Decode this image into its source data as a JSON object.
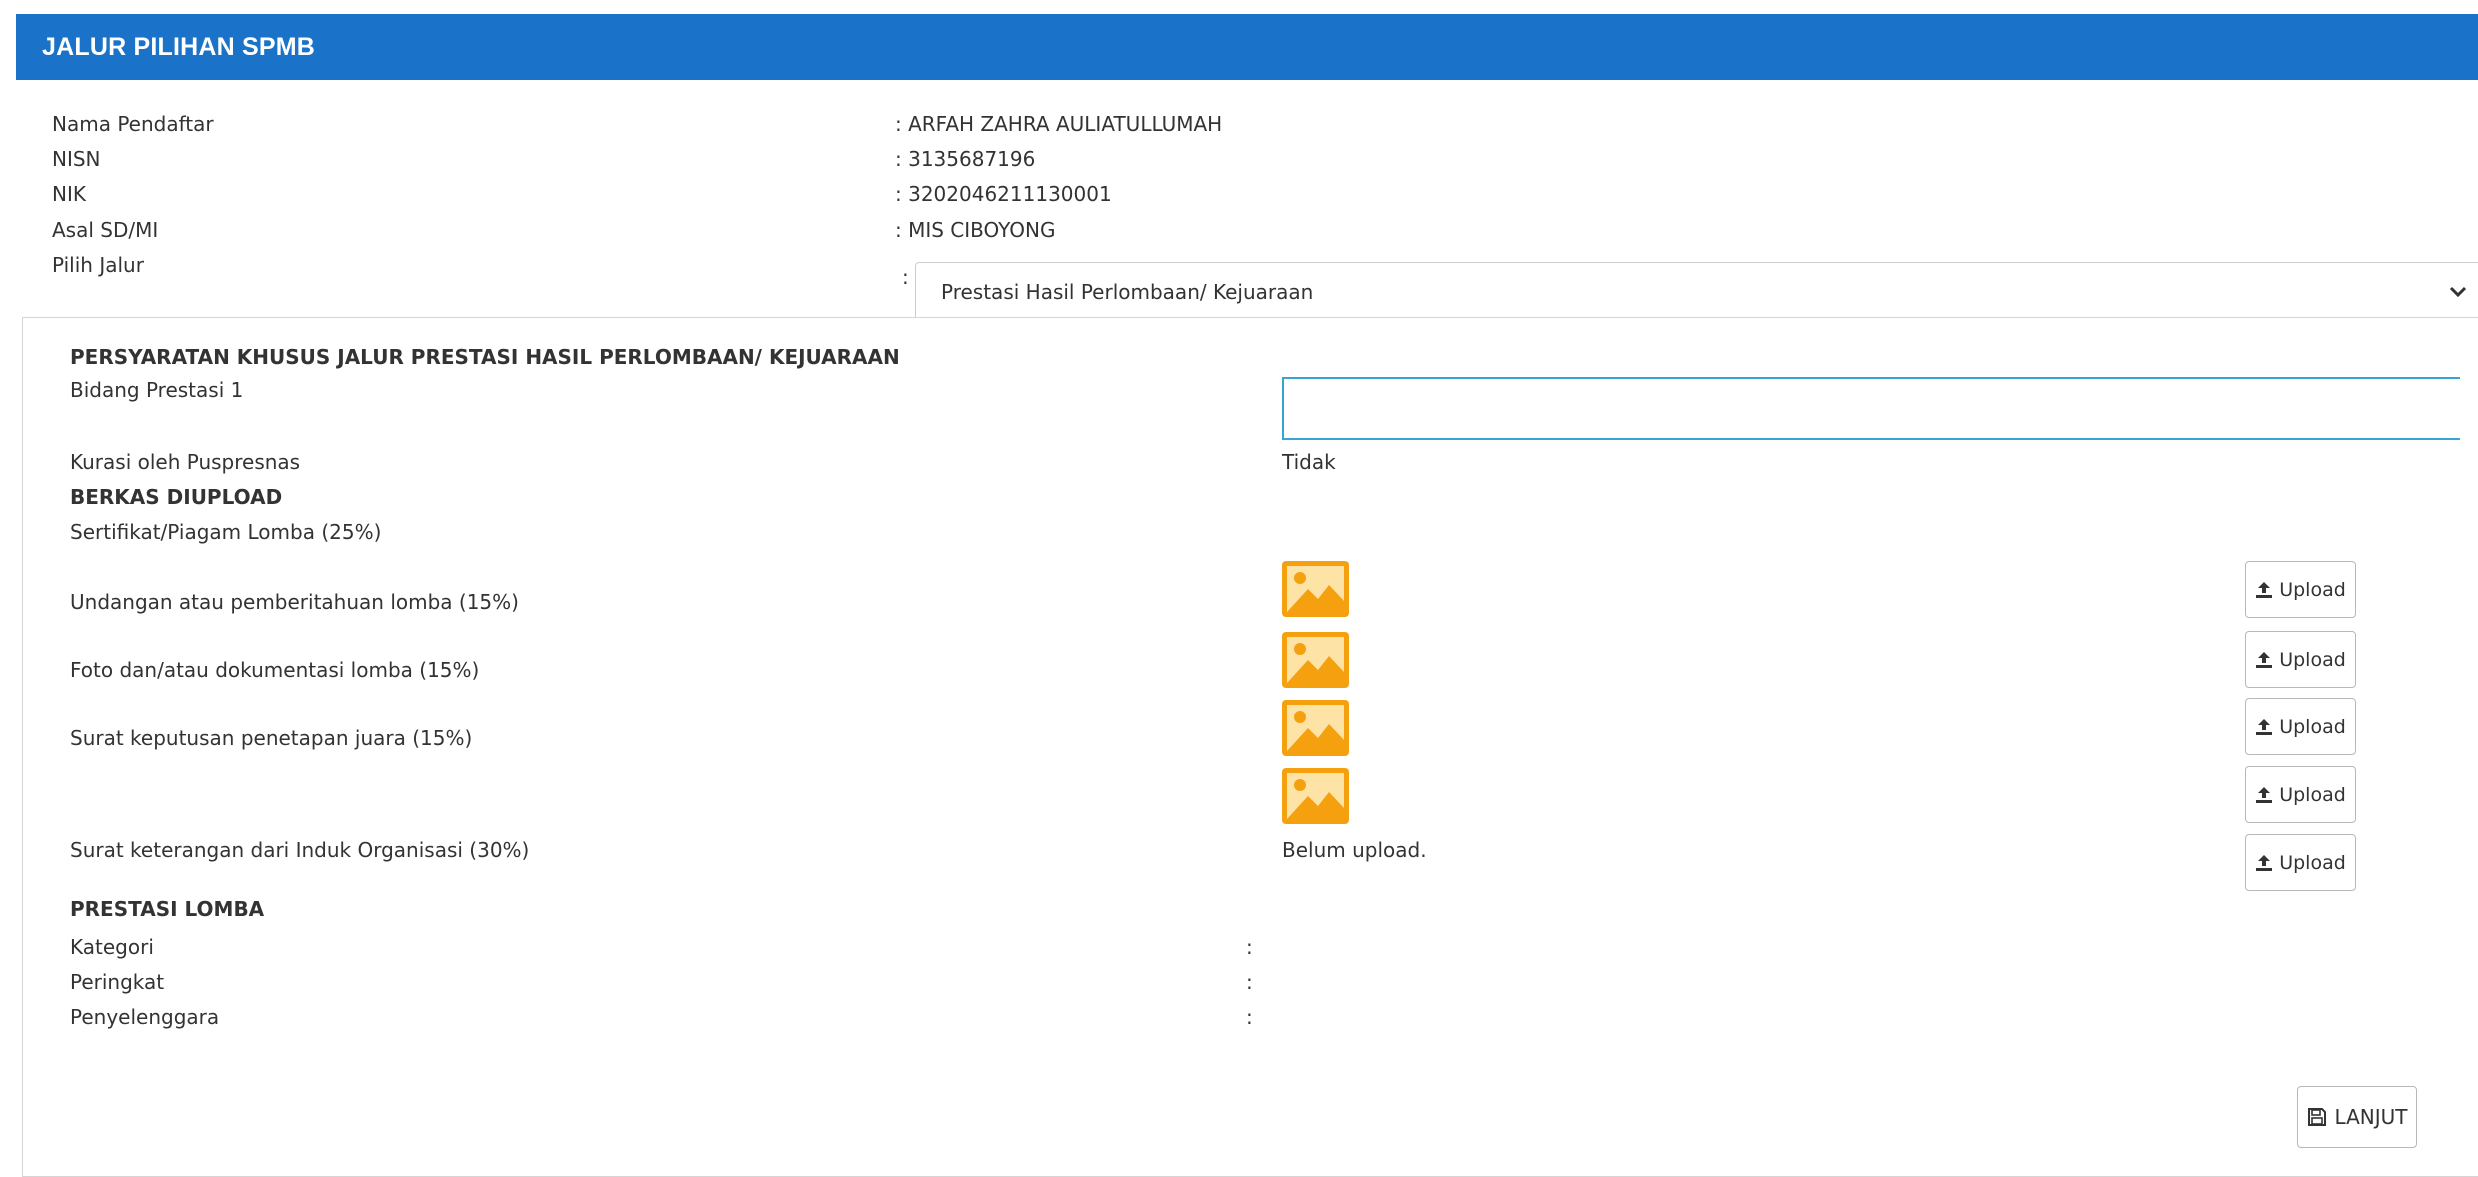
{
  "header": {
    "title": "JALUR PILIHAN SPMB",
    "color": "#1a73c9"
  },
  "student": {
    "rows": [
      {
        "label": "Nama Pendaftar",
        "value": ": ARFAH ZAHRA AULIATULLUMAH"
      },
      {
        "label": "NISN",
        "value": ": 3135687196"
      },
      {
        "label": "NIK",
        "value": ": 3202046211130001"
      },
      {
        "label": "Asal SD/MI",
        "value": ": MIS CIBOYONG"
      }
    ],
    "jalur_label": "Pilih Jalur",
    "jalur_colon": ":",
    "jalur_selected": "Prestasi Hasil Perlombaan/ Kejuaraan"
  },
  "requirements": {
    "heading": "PERSYARATAN KHUSUS JALUR PRESTASI HASIL PERLOMBAAN/ KEJUARAAN",
    "bidang_label": "Bidang Prestasi 1",
    "bidang_value": "",
    "kurasi_label": "Kurasi oleh Puspresnas",
    "kurasi_value": "Tidak",
    "berkas_heading": "BERKAS DIUPLOAD",
    "upload_label": "Upload",
    "files": [
      {
        "label": "Sertifikat/Piagam Lomba (25%)",
        "status": "image"
      },
      {
        "label": "Undangan atau pemberitahuan lomba (15%)",
        "status": "image"
      },
      {
        "label": "Foto dan/atau dokumentasi lomba (15%)",
        "status": "image"
      },
      {
        "label": "Surat keputusan penetapan juara (15%)",
        "status": "image"
      },
      {
        "label": "Surat keterangan dari Induk Organisasi (30%)",
        "status": "Belum upload."
      }
    ],
    "thumbnail_color": "#f5a10f",
    "input_focus_color": "#36a5d6"
  },
  "prestasi": {
    "heading": "PRESTASI LOMBA",
    "rows": [
      {
        "label": "Kategori",
        "value": ":"
      },
      {
        "label": "Peringkat",
        "value": ":"
      },
      {
        "label": "Penyelenggara",
        "value": ":"
      }
    ]
  },
  "actions": {
    "lanjut_label": "LANJUT"
  }
}
